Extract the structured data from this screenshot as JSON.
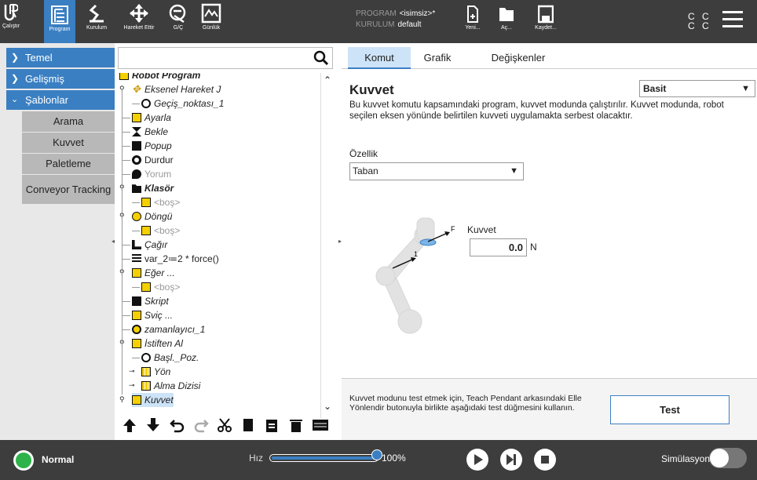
{
  "topbar": {
    "nav": [
      {
        "label": "Çalıştır",
        "icon": "ur-logo-icon"
      },
      {
        "label": "Program",
        "icon": "program-icon",
        "active": true
      },
      {
        "label": "Kurulum",
        "icon": "installation-icon"
      },
      {
        "label": "Hareket Ettir",
        "icon": "move-icon"
      },
      {
        "label": "G/Ç",
        "icon": "io-icon"
      },
      {
        "label": "Günlük",
        "icon": "log-icon"
      }
    ],
    "program_label": "PROGRAM",
    "program_value": "<isimsiz>*",
    "installation_label": "KURULUM",
    "installation_value": "default",
    "file_buttons": [
      {
        "label": "Yeni...",
        "icon": "new-file-icon"
      },
      {
        "label": "Aç...",
        "icon": "folder-open-icon"
      },
      {
        "label": "Kaydet...",
        "icon": "save-icon"
      }
    ],
    "cc1": "C C",
    "cc2": "C C"
  },
  "sidebar": {
    "categories": [
      {
        "label": "Temel",
        "expanded": false
      },
      {
        "label": "Gelişmiş",
        "expanded": false
      },
      {
        "label": "Şablonlar",
        "expanded": true
      }
    ],
    "items": [
      "Arama",
      "Kuvvet",
      "Paletleme",
      "Conveyor Tracking"
    ]
  },
  "tree": {
    "rows": [
      {
        "label": "Robot Program",
        "style": "bold",
        "icon": "program-icon"
      },
      {
        "label": "Eksenel Hareket J",
        "style": "it",
        "icon": "move-icon"
      },
      {
        "label": "Geçiş_noktası_1",
        "style": "it",
        "icon": "waypoint-icon"
      },
      {
        "label": "Ayarla",
        "style": "it",
        "icon": "set-icon"
      },
      {
        "label": "Bekle",
        "style": "it",
        "icon": "wait-icon"
      },
      {
        "label": "Popup",
        "style": "it",
        "icon": "popup-icon"
      },
      {
        "label": "Durdur",
        "style": "",
        "icon": "halt-icon"
      },
      {
        "label": "Yorum",
        "style": "gray",
        "icon": "comment-icon"
      },
      {
        "label": "Klasör",
        "style": "bold",
        "icon": "folder-icon"
      },
      {
        "label": "<boş>",
        "style": "gray",
        "icon": "empty-icon"
      },
      {
        "label": "Döngü",
        "style": "it",
        "icon": "loop-icon"
      },
      {
        "label": "<boş>",
        "style": "gray",
        "icon": "empty-icon"
      },
      {
        "label": "Çağır",
        "style": "it",
        "icon": "call-icon"
      },
      {
        "label": "var_2≔2 * force()",
        "style": "",
        "icon": "assignment-icon"
      },
      {
        "label": "Eğer ...",
        "style": "it",
        "icon": "if-icon"
      },
      {
        "label": "<boş>",
        "style": "gray",
        "icon": "empty-icon"
      },
      {
        "label": "Skript",
        "style": "it",
        "icon": "script-icon"
      },
      {
        "label": "Sviç ...",
        "style": "it",
        "icon": "switch-icon"
      },
      {
        "label": "zamanlayıcı_1",
        "style": "it",
        "icon": "timer-icon"
      },
      {
        "label": "İstiften Al",
        "style": "it",
        "icon": "depallet-icon"
      },
      {
        "label": "Başl._Poz.",
        "style": "it",
        "icon": "waypoint-icon"
      },
      {
        "label": "Yön",
        "style": "it",
        "icon": "direction-icon"
      },
      {
        "label": "Alma Dizisi",
        "style": "it",
        "icon": "pattern-icon"
      },
      {
        "label": "Kuvvet",
        "style": "it",
        "icon": "force-icon"
      }
    ]
  },
  "right": {
    "tabs": [
      "Komut",
      "Grafik",
      "Değişkenler"
    ],
    "active_tab": "Komut",
    "title": "Kuvvet",
    "mode": "Basit",
    "description": "Bu kuvvet komutu kapsamındaki program, kuvvet modunda çalıştırılır. Kuvvet modunda, robot seçilen eksen yönünde belirtilen kuvveti uygulamakta serbest olacaktır.",
    "feature_label": "Özellik",
    "feature_value": "Taban",
    "force_label": "Kuvvet",
    "force_value": "0.0",
    "force_unit": "N",
    "diagram_f": "F",
    "diagram_1": "1",
    "hint": "Kuvvet modunu test etmek için, Teach Pendant arkasındaki Elle Yönlendir butonuyla birlikte aşağıdaki test düğmesini kullanın.",
    "test_label": "Test"
  },
  "footer": {
    "status": "Normal",
    "status_color": "#2db34a",
    "speed_label": "Hız",
    "speed_value": "100%",
    "speed_fraction": 1.0,
    "simulation_label": "Simülasyon",
    "simulation_on": false
  },
  "colors": {
    "accent": "#3a7fc2",
    "topbar": "#3d3d3d",
    "selected": "#cde3f8"
  }
}
